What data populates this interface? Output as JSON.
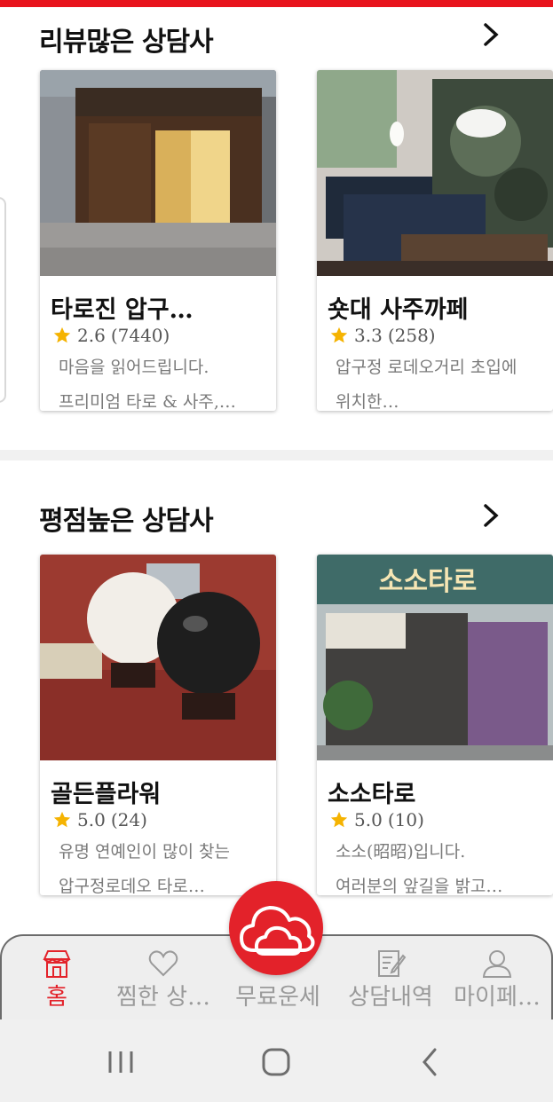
{
  "sections": [
    {
      "title": "리뷰많은 상담사",
      "arrow": ">",
      "cards": [
        {
          "name": "타로진 압구…",
          "rating": "2.6",
          "reviews": "(7440)",
          "desc1": "마음을 읽어드립니다.",
          "desc2": "프리미엄 타로 & 사주,…"
        },
        {
          "name": "숏대 사주까페",
          "rating": "3.3",
          "reviews": "(258)",
          "desc1": "압구정 로데오거리 초입에",
          "desc2": "위치한…"
        }
      ]
    },
    {
      "title": "평점높은 상담사",
      "arrow": ">",
      "cards": [
        {
          "name": "골든플라워",
          "rating": "5.0",
          "reviews": "(24)",
          "desc1": "유명 연예인이 많이 찾는",
          "desc2": "압구정로데오 타로…"
        },
        {
          "name": "소소타로",
          "rating": "5.0",
          "reviews": "(10)",
          "desc1": "소소(昭昭)입니다.",
          "desc2": "여러분의 앞길을 밝고…",
          "sign_text": "소소타로"
        }
      ]
    }
  ],
  "bottom_nav": {
    "items": [
      {
        "label": "홈",
        "icon": "shop-icon",
        "active": true
      },
      {
        "label": "찜한 상…",
        "icon": "heart-icon",
        "active": false
      },
      {
        "label": "무료운세",
        "icon": "cloud-icon",
        "active": false
      },
      {
        "label": "상담내역",
        "icon": "notepad-icon",
        "active": false
      },
      {
        "label": "마이페…",
        "icon": "person-icon",
        "active": false
      }
    ]
  },
  "system_nav": {
    "icons": [
      "recent-apps-icon",
      "home-icon",
      "back-icon"
    ]
  },
  "colors": {
    "accent": "#e3222a",
    "star": "#f5b301",
    "top_bar": "#e8141c"
  }
}
